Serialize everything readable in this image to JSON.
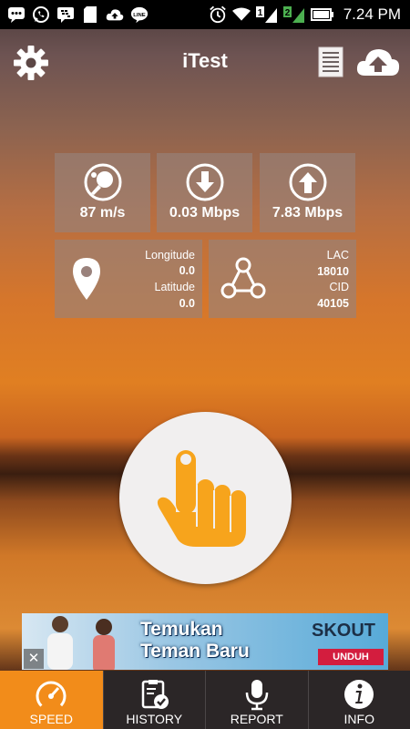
{
  "status_bar": {
    "time": "7.24 PM",
    "left_icons": [
      "messages-icon",
      "whatsapp-icon",
      "bbm-icon",
      "sd-card-icon",
      "cloud-upload-icon",
      "line-icon"
    ],
    "right_icons": [
      "alarm-icon",
      "wifi-icon",
      "signal-1-icon",
      "signal-2-icon",
      "battery-icon"
    ],
    "sim1": "1",
    "sim2": "2"
  },
  "header": {
    "title": "iTest"
  },
  "tiles": {
    "ping": {
      "value": "87 m/s",
      "icon": "ping-pong-icon"
    },
    "download": {
      "value": "0.03 Mbps",
      "icon": "download-arrow-icon"
    },
    "upload": {
      "value": "7.83 Mbps",
      "icon": "upload-arrow-icon"
    },
    "location": {
      "icon": "map-pin-icon",
      "longitude_label": "Longitude",
      "longitude_value": "0.0",
      "latitude_label": "Latitude",
      "latitude_value": "0.0"
    },
    "cell": {
      "icon": "network-nodes-icon",
      "lac_label": "LAC",
      "lac_value": "18010",
      "cid_label": "CID",
      "cid_value": "40105"
    }
  },
  "start_button": {
    "icon": "tap-hand-icon"
  },
  "ad": {
    "line1": "Temukan",
    "line2": "Teman Baru",
    "logo": "SKOUT",
    "button": "UNDUH",
    "close": "✕"
  },
  "nav": {
    "items": [
      {
        "label": "SPEED",
        "icon": "speedometer-icon",
        "active": true
      },
      {
        "label": "HISTORY",
        "icon": "clipboard-check-icon",
        "active": false
      },
      {
        "label": "REPORT",
        "icon": "microphone-icon",
        "active": false
      },
      {
        "label": "INFO",
        "icon": "info-icon",
        "active": false
      }
    ]
  },
  "colors": {
    "accent": "#f28c1a",
    "hand": "#f7a41c",
    "tile_bg": "#968279",
    "nav_bg": "#2b2627"
  }
}
